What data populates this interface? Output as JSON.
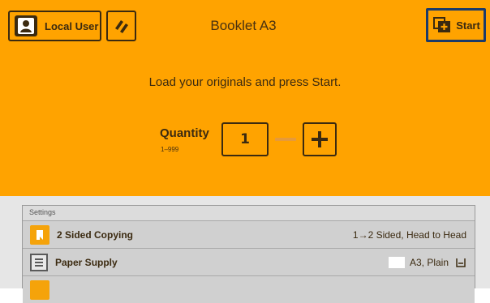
{
  "header": {
    "user_label": "Local User",
    "title": "Booklet A3",
    "start_label": "Start",
    "background_color": "#ffa300",
    "start_border_color": "#1c3b6a"
  },
  "main": {
    "instruction": "Load your originals and press Start.",
    "quantity_label": "Quantity",
    "quantity_range": "1–999",
    "quantity_value": "1"
  },
  "settings": {
    "title": "Settings",
    "rows": [
      {
        "label": "2 Sided Copying",
        "value": "1→2 Sided, Head to Head",
        "icon": "two-sided-copy-icon"
      },
      {
        "label": "Paper Supply",
        "value": "A3, Plain",
        "icon": "paper-tray-icon"
      }
    ]
  }
}
